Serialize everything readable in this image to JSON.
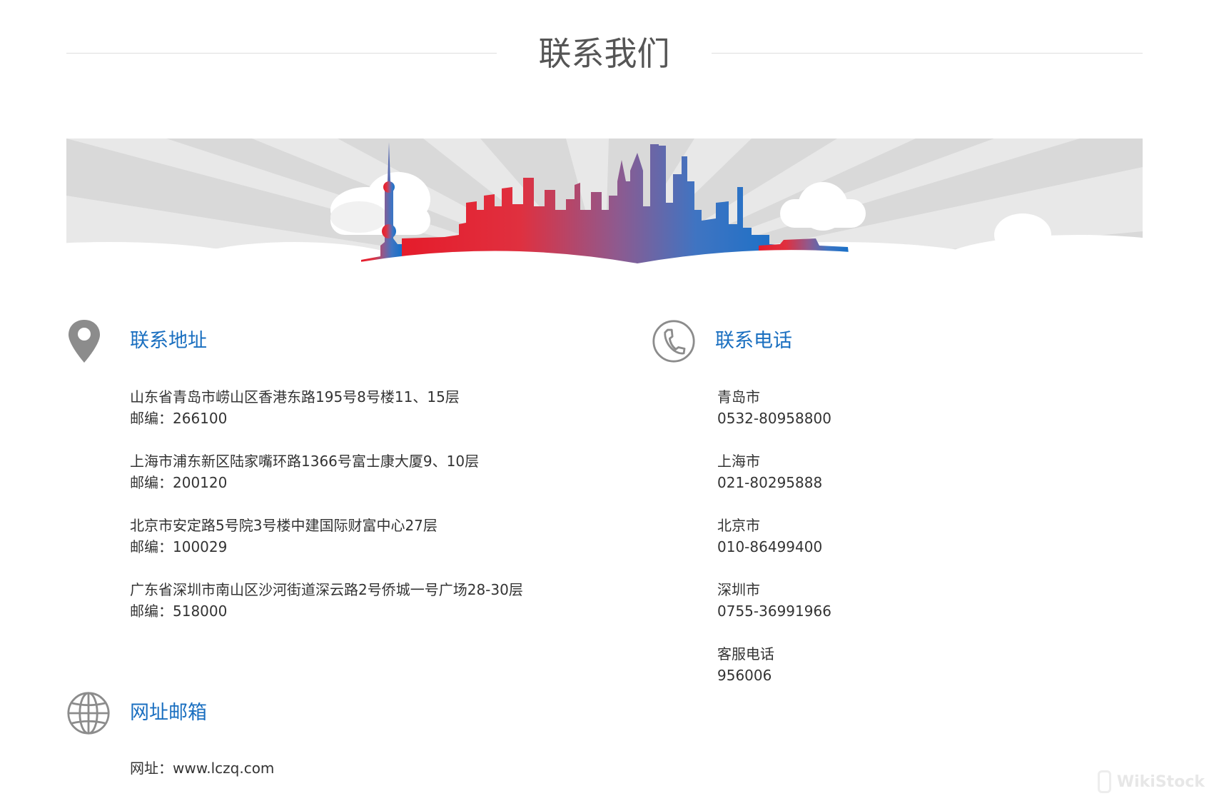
{
  "page": {
    "title": "联系我们"
  },
  "address_section": {
    "title": "联系地址",
    "icon": "map-pin-icon",
    "items": [
      {
        "address": "山东省青岛市崂山区香港东路195号8号楼11、15层",
        "postcode": "邮编：266100"
      },
      {
        "address": "上海市浦东新区陆家嘴环路1366号富士康大厦9、10层",
        "postcode": "邮编：200120"
      },
      {
        "address": "北京市安定路5号院3号楼中建国际财富中心27层",
        "postcode": "邮编：100029"
      },
      {
        "address": "广东省深圳市南山区沙河街道深云路2号侨城一号广场28-30层",
        "postcode": "邮编：518000"
      }
    ]
  },
  "phone_section": {
    "title": "联系电话",
    "icon": "phone-icon",
    "items": [
      {
        "city": "青岛市",
        "number": "0532-80958800"
      },
      {
        "city": "上海市",
        "number": "021-80295888"
      },
      {
        "city": "北京市",
        "number": "010-86499400"
      },
      {
        "city": "深圳市",
        "number": "0755-36991966"
      },
      {
        "city": "客服电话",
        "number": "956006"
      }
    ]
  },
  "web_section": {
    "title": "网址邮箱",
    "icon": "globe-icon",
    "website": "网址：www.lczq.com"
  },
  "watermark": {
    "text": "WikiStock"
  },
  "colors": {
    "accent_blue": "#1a6fc0",
    "skyline_red": "#e51c2b",
    "skyline_blue": "#1570c8"
  }
}
